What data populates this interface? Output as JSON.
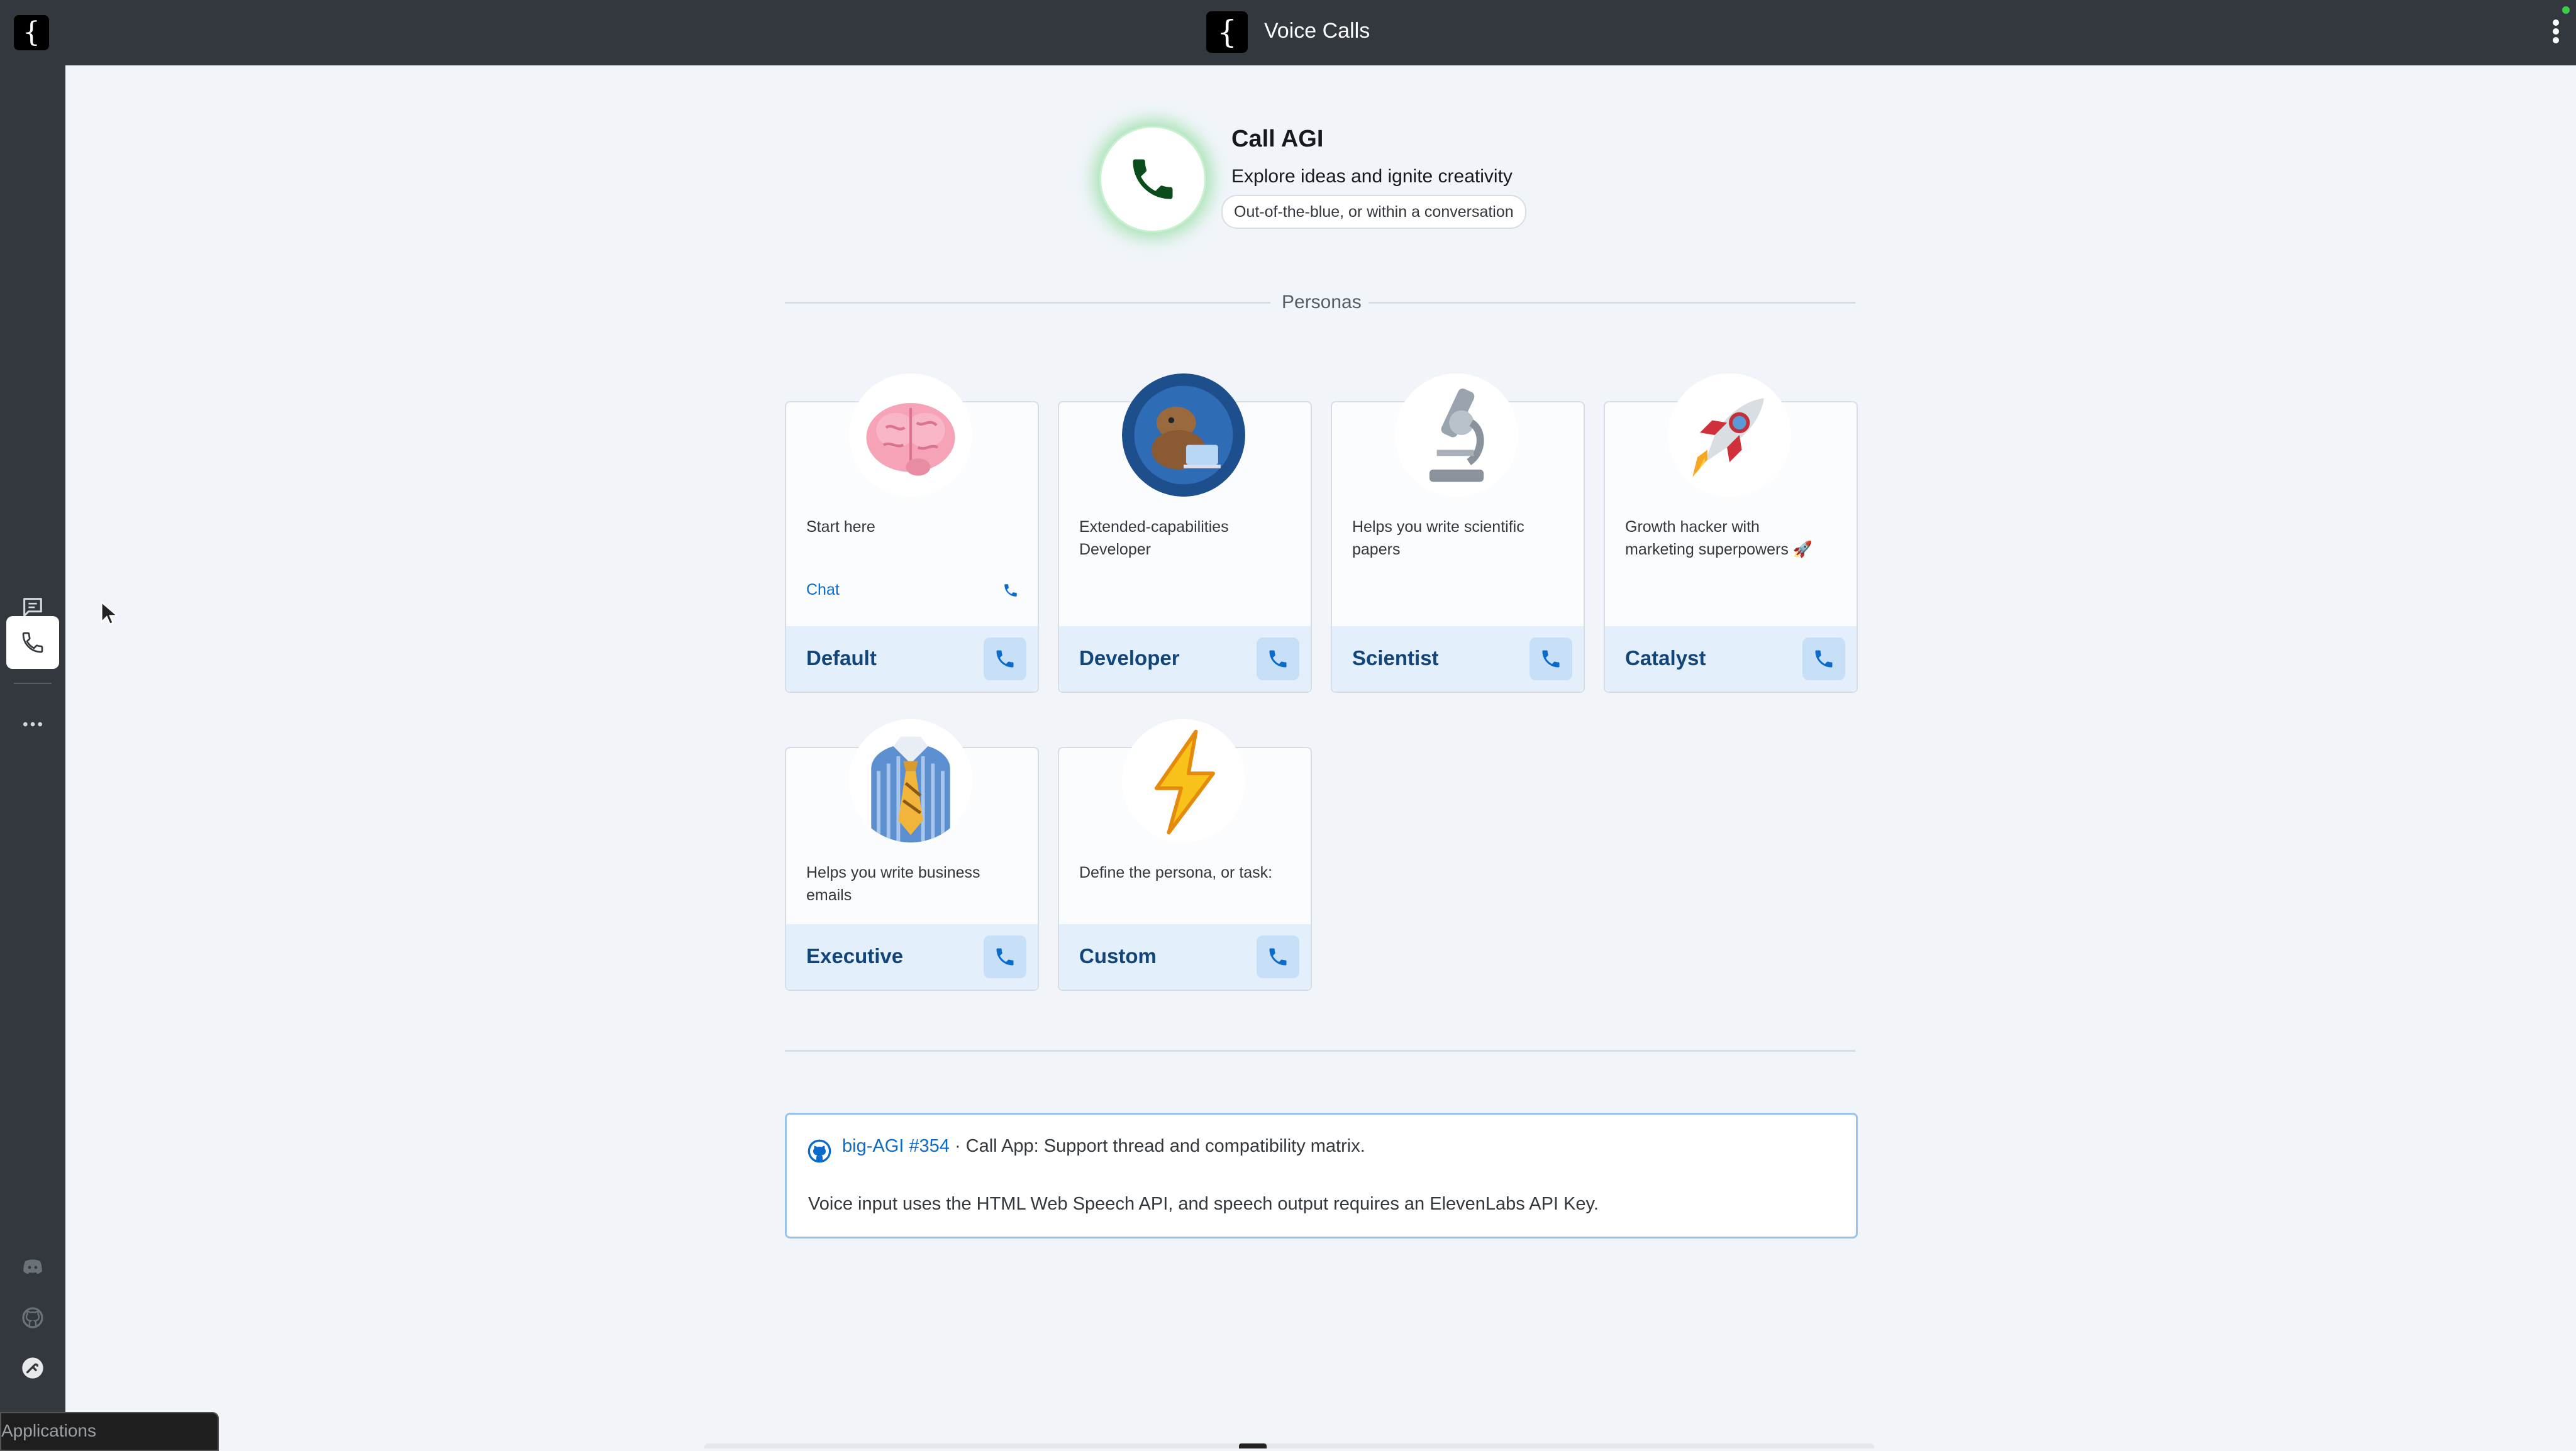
{
  "topbar": {
    "title": "Voice Calls",
    "logo_glyph": "{"
  },
  "sidebar": {
    "items": [
      {
        "name": "chat",
        "icon": "chat-icon"
      },
      {
        "name": "call",
        "icon": "phone-icon",
        "active": true
      },
      {
        "name": "more",
        "icon": "more-icon"
      }
    ],
    "bottom_icons": [
      "discord-icon",
      "github-icon",
      "support-icon"
    ]
  },
  "hero": {
    "title": "Call AGI",
    "subtitle": "Explore ideas and ignite creativity",
    "chip": "Out-of-the-blue, or within a conversation"
  },
  "personas_label": "Personas",
  "personas": [
    {
      "name": "Default",
      "description": "Start here",
      "chat_label": "Chat"
    },
    {
      "name": "Developer",
      "description": "Extended-capabilities Developer"
    },
    {
      "name": "Scientist",
      "description": "Helps you write scientific papers"
    },
    {
      "name": "Catalyst",
      "description": "Growth hacker with marketing superpowers 🚀"
    },
    {
      "name": "Executive",
      "description": "Helps you write business emails"
    },
    {
      "name": "Custom",
      "description": "Define the persona, or task:"
    }
  ],
  "info": {
    "link_text": "big-AGI #354",
    "link_suffix": " · Call App: Support thread and compatibility matrix.",
    "note": "Voice input uses the HTML Web Speech API, and speech output requires an ElevenLabs API Key."
  },
  "taskbar_tooltip": "Applications",
  "colors": {
    "accent": "#0b6bcb",
    "call_green": "#1f7a2e",
    "rail": "#32383e"
  }
}
